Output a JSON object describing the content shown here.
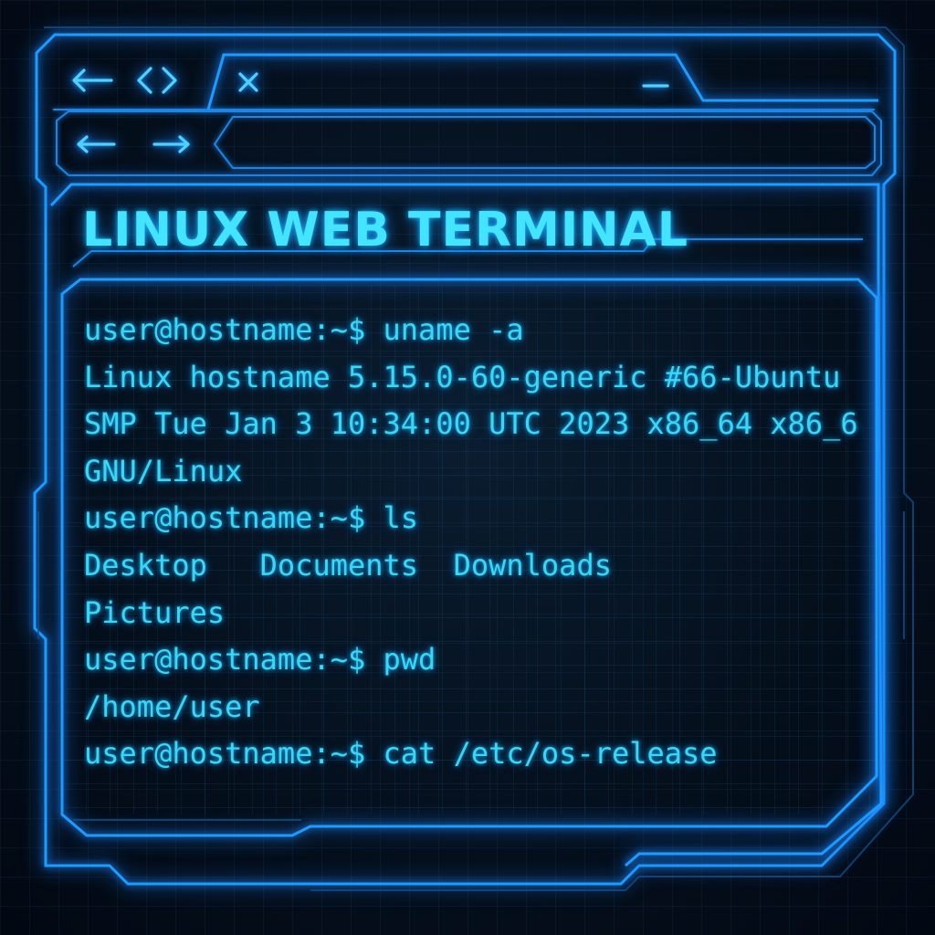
{
  "window": {
    "tab_close_glyph": "×",
    "minimize_glyph": "_",
    "accent_color": "#1e9bff",
    "text_color": "#3ad6f2",
    "background_color": "#030b16"
  },
  "titlebar": {
    "icons": [
      "back-arrow-icon",
      "code-brackets-icon",
      "close-icon",
      "minimize-icon"
    ]
  },
  "toolbar": {
    "icons": [
      "back-arrow-icon",
      "forward-arrow-icon"
    ],
    "address_value": ""
  },
  "page": {
    "title": "LINUX WEB TERMINAL"
  },
  "terminal": {
    "lines": [
      "user@hostname:~$ uname -a",
      "Linux hostname 5.15.0-60-generic #66-Ubuntu",
      "SMP Tue Jan 3 10:34:00 UTC 2023 x86_64 x86_6",
      "GNU/Linux",
      "user@hostname:~$ ls",
      "Desktop   Documents  Downloads",
      "Pictures",
      "user@hostname:~$ pwd",
      "/home/user",
      "user@hostname:~$ cat /etc/os-release"
    ]
  }
}
